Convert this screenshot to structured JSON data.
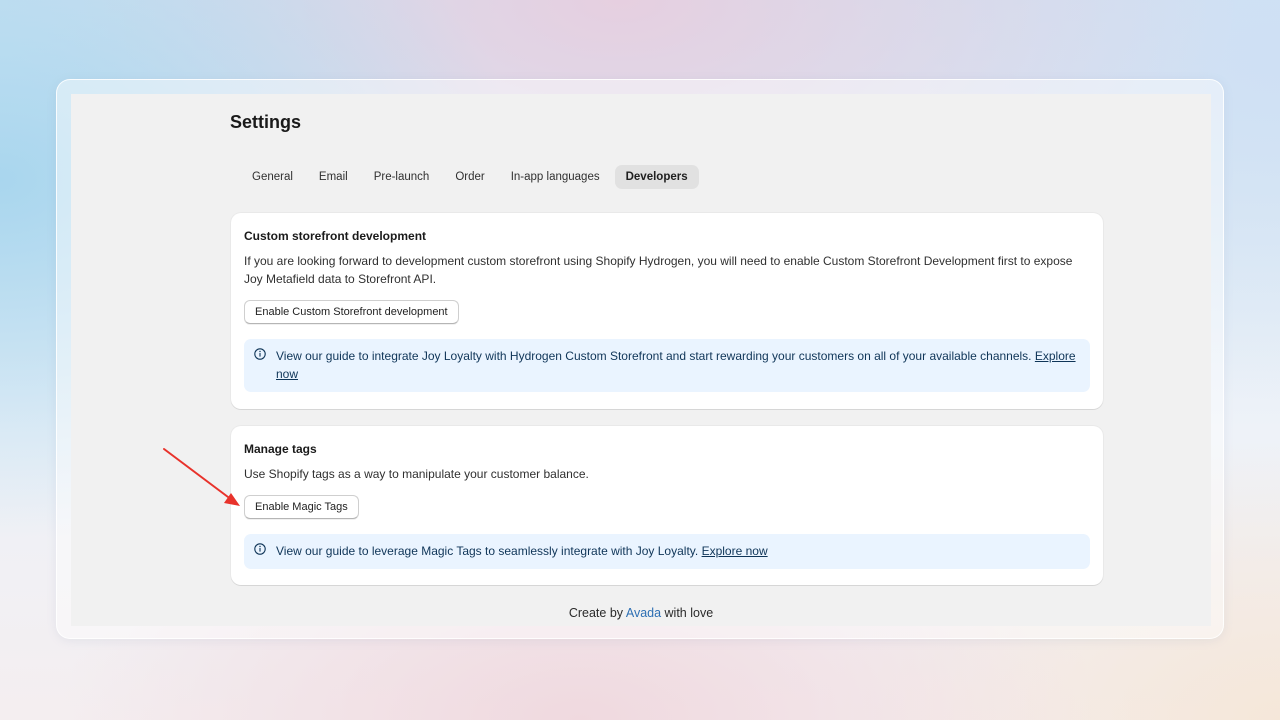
{
  "page": {
    "title": "Settings"
  },
  "tabs": [
    {
      "label": "General",
      "active": false
    },
    {
      "label": "Email",
      "active": false
    },
    {
      "label": "Pre-launch",
      "active": false
    },
    {
      "label": "Order",
      "active": false
    },
    {
      "label": "In-app languages",
      "active": false
    },
    {
      "label": "Developers",
      "active": true
    }
  ],
  "storefront": {
    "title": "Custom storefront development",
    "description": "If you are looking forward to development custom storefront using Shopify Hydrogen, you will need to enable Custom Storefront Development first to expose Joy Metafield data to Storefront API.",
    "button_label": "Enable Custom Storefront development",
    "banner_text": "View our guide to integrate Joy Loyalty with Hydrogen Custom Storefront and start rewarding your customers on all of your available channels.",
    "banner_link": "Explore now"
  },
  "tags": {
    "title": "Manage tags",
    "description": "Use Shopify tags as a way to manipulate your customer balance.",
    "button_label": "Enable Magic Tags",
    "banner_text": "View our guide to leverage Magic Tags to seamlessly integrate with Joy Loyalty.",
    "banner_link": "Explore now"
  },
  "footer": {
    "prefix": "Create by",
    "brand": "Avada",
    "suffix": "with love"
  },
  "colors": {
    "annotation_arrow": "#e8322b",
    "banner_bg": "#eaf4ff",
    "link_brand": "#2d6fb3"
  },
  "icons": {
    "banner_icon": "info-circle-icon"
  }
}
